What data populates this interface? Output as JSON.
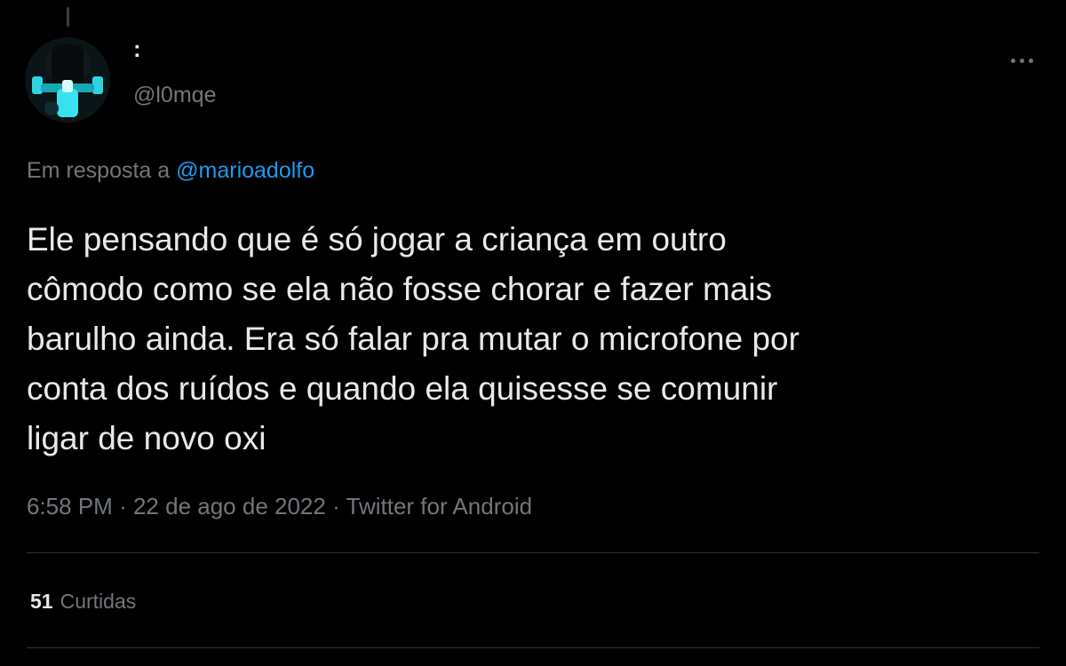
{
  "author": {
    "display_name": ":",
    "handle": "@l0mqe"
  },
  "reply": {
    "prefix": "Em resposta a",
    "mention": "@marioadolfo"
  },
  "tweet": {
    "text": "Ele pensando que é só jogar a criança em outro\ncômodo como se ela não fosse chorar e fazer mais\nbarulho ainda. Era só falar pra mutar o microfone por\nconta dos ruídos e quando ela quisesse se comunir\nligar de novo oxi",
    "time": "6:58 PM",
    "date": "22 de ago de 2022",
    "separator": "·",
    "source": "Twitter for Android"
  },
  "stats": {
    "likes_count": "51",
    "likes_label": "Curtidas"
  },
  "icons": {
    "more": "more-horizontal-icon"
  },
  "colors": {
    "background": "#000000",
    "text": "#e7e9ea",
    "secondary": "#71767b",
    "link": "#1d9bf0",
    "divider": "#2f3336"
  }
}
